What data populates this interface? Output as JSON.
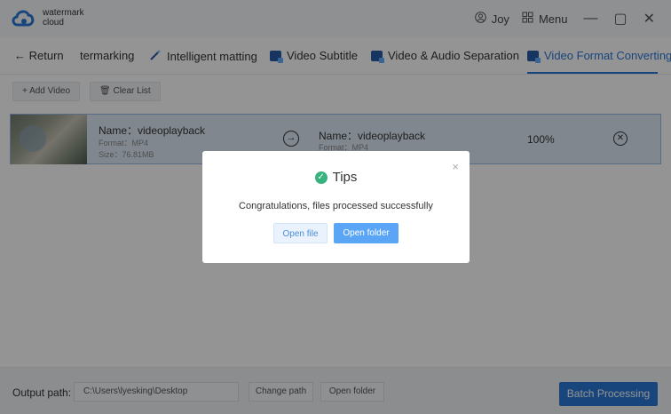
{
  "app": {
    "logo_line1": "watermark",
    "logo_line2": "cloud",
    "user": "Joy",
    "menu_label": "Menu",
    "minimize": "—",
    "maximize": "▢",
    "close": "✕"
  },
  "nav": {
    "return_label": "← Return",
    "tabs": [
      {
        "label": "termarking"
      },
      {
        "label": "Intelligent matting"
      },
      {
        "label": "Video Subtitle"
      },
      {
        "label": "Video & Audio Separation"
      },
      {
        "label": "Video Format Converting",
        "active": true
      }
    ]
  },
  "toolbar": {
    "add_video": "+ Add Video",
    "clear_list": "🗑 Clear List"
  },
  "file": {
    "source_name": "Name：videoplayback",
    "source_format": "Format：MP4",
    "source_size": "Size：76.81MB",
    "target_name": "Name：videoplayback",
    "target_format": "Format：MP4",
    "progress": "100%"
  },
  "dialog": {
    "title": "Tips",
    "message": "Congratulations, files processed successfully",
    "open_file": "Open file",
    "open_folder": "Open folder",
    "close": "×"
  },
  "footer": {
    "output_label": "Output path:",
    "path": "C:\\Users\\lyesking\\Desktop",
    "change_path": "Change path",
    "open_folder": "Open folder",
    "batch": "Batch Processing"
  },
  "colors": {
    "accent": "#2a78d6",
    "row_highlight": "#dfe9f7",
    "success": "#36b37e"
  }
}
